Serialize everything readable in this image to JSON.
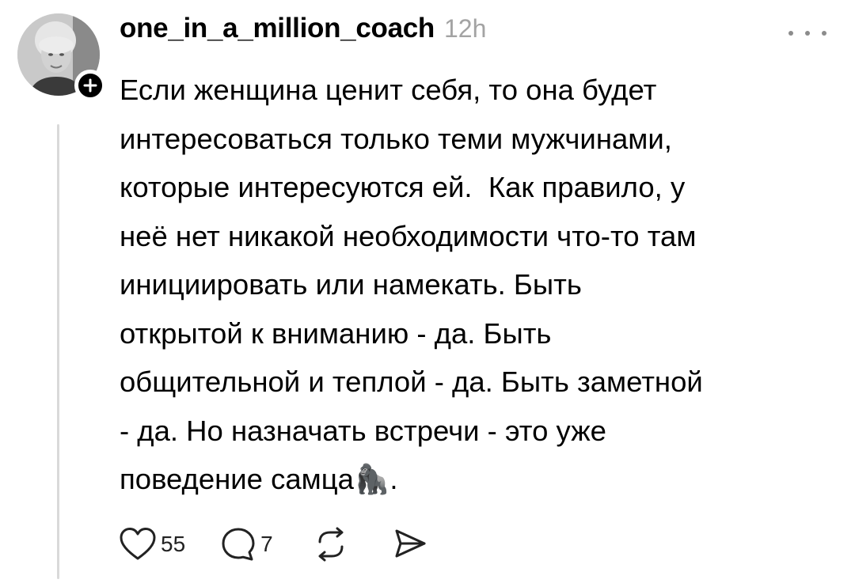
{
  "post": {
    "username": "one_in_a_million_coach",
    "timestamp": "12h",
    "text": "Если женщина ценит себя, то она будет\nинтересоваться только теми мужчинами,\nкоторые интересуются ей.  Как правило, у\nнеё нет никакой необходимости что-то там\nинициировать или намекать. Быть\nоткрытой к вниманию - да. Быть\nобщительной и теплой - да. Быть заметной\n- да. Но назначать встречи - это уже\nповедение самца🦍."
  },
  "actions": {
    "like_count": "55",
    "reply_count": "7"
  },
  "icons": {
    "avatar": "avatar-photo",
    "follow": "plus-icon",
    "more": "more-dots-icon",
    "like": "heart-icon",
    "reply": "comment-bubble-icon",
    "repost": "repost-icon",
    "share": "send-icon"
  },
  "colors": {
    "text": "#000000",
    "secondary": "#a3a3a3",
    "thread_line": "#d9d9d9",
    "background": "#ffffff"
  }
}
